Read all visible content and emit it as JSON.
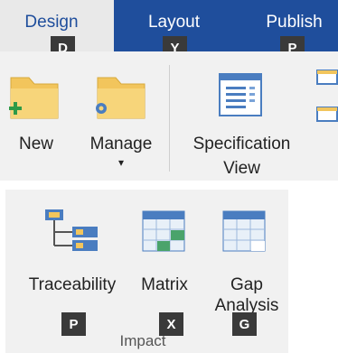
{
  "tabs": [
    {
      "label": "Design",
      "keytip": "D"
    },
    {
      "label": "Layout",
      "keytip": "Y"
    },
    {
      "label": "Publish",
      "keytip": "P"
    }
  ],
  "toolbar": {
    "new_label": "New",
    "manage_label": "Manage",
    "manage_arrow": "▾",
    "spec_view_line1": "Specification",
    "spec_view_line2": "View"
  },
  "impact": {
    "group_label": "Impact",
    "traceability_label": "Traceability",
    "traceability_keytip": "P",
    "matrix_label": "Matrix",
    "matrix_keytip": "X",
    "gap_line1": "Gap",
    "gap_line2": "Analysis",
    "gap_keytip": "G"
  },
  "colors": {
    "ribbon_blue": "#1f4e9c",
    "folder": "#f2c55c",
    "plus": "#2e9a47",
    "gear": "#4a7dc0",
    "keytip_bg": "#3a3a3a"
  }
}
